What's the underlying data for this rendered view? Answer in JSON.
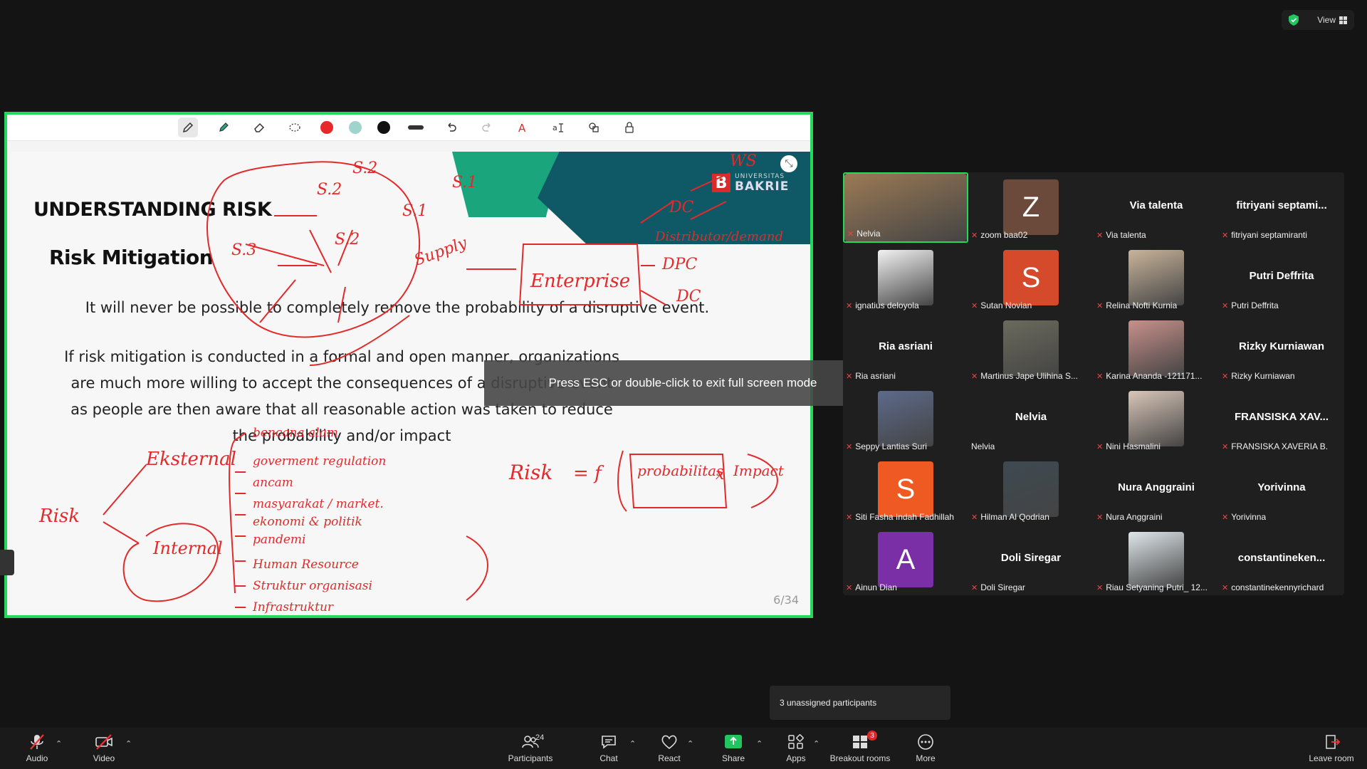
{
  "top_right": {
    "view_label": "View"
  },
  "toolbar": {
    "colors": [
      "#e8272a",
      "#9fd4cc",
      "#111111"
    ]
  },
  "slide": {
    "title": "UNDERSTANDING RISK",
    "subtitle": "Risk Mitigation",
    "para1": "It will never be possible to completely remove the probability of a disruptive event.",
    "para2": "If risk mitigation is conducted in a formal and open manner, organizations are much more willing to accept the consequences of a disruptive event as people are then aware that all reasonable action was taken to reduce the probability and/or impact",
    "page": "6/34",
    "logo_small": "UNIVERSITAS",
    "logo_big": "BAKRIE",
    "logo_letter": "B"
  },
  "ink": {
    "s2a": "S.2",
    "s2b": "S.2",
    "s2c": "S.2",
    "s1": "S.1",
    "s3": "S.3",
    "s1b": "S.1",
    "supply": "Supply",
    "enterprise": "Enterprise",
    "ws": "WS",
    "dc1": "DC",
    "distributor": "Distributor/demand",
    "dpc": "DPC",
    "dc2": "DC",
    "risk_left": "Risk",
    "eksternal": "Eksternal",
    "internal": "Internal",
    "b1": "bencana alam",
    "b2": "goverment regulation",
    "b3": "ancam",
    "b4": "masyarakat / market.",
    "b5": "ekonomi & politik",
    "b6": "pandemi",
    "b7": "Human Resource",
    "b8": "Struktur organisasi",
    "b9": "Infrastruktur",
    "formula_risk": "Risk",
    "formula_eq": "= f",
    "formula_prob": "probabilitas",
    "formula_x": "x",
    "formula_impact": "Impact"
  },
  "fullscreen_tip": "Press ESC or double-click to exit full screen mode",
  "gallery": [
    {
      "name": "Nelvia",
      "type": "photo",
      "color": "#9b7a55",
      "active": true
    },
    {
      "name": "zoom baa02",
      "type": "letter",
      "letter": "Z",
      "color": "#6b4a3c"
    },
    {
      "name": "Via talenta",
      "type": "text",
      "big": "Via talenta"
    },
    {
      "name": "fitriyani septamiranti",
      "type": "text",
      "big": "fitriyani  septami..."
    },
    {
      "name": "ignatius deloyola",
      "type": "photo",
      "color": "#f2f2f2"
    },
    {
      "name": "Sutan Novian",
      "type": "letter",
      "letter": "S",
      "color": "#d64a2c"
    },
    {
      "name": "Relina Nofti Kurnia",
      "type": "photo",
      "color": "#c9b49a"
    },
    {
      "name": "Putri Deffrita",
      "type": "text",
      "big": "Putri Deffrita"
    },
    {
      "name": "Ria asriani",
      "type": "text",
      "big": "Ria asriani"
    },
    {
      "name": "Martinus Jape Ulihina S...",
      "type": "photo",
      "color": "#6b6a5c"
    },
    {
      "name": "Karina Ananda -121171...",
      "type": "photo",
      "color": "#c8908a"
    },
    {
      "name": "Rizky Kurniawan",
      "type": "text",
      "big": "Rizky Kurniawan"
    },
    {
      "name": "Seppy Lantias Suri",
      "type": "photo",
      "color": "#5c6a8a"
    },
    {
      "name": "Nelvia",
      "type": "text",
      "big": "Nelvia",
      "no_mic": true
    },
    {
      "name": "Nini Hasmalini",
      "type": "photo",
      "color": "#d9c6b8"
    },
    {
      "name": "FRANSISKA XAVERIA B.",
      "type": "text",
      "big": "FRANSISKA  XAV..."
    },
    {
      "name": "Siti Fasha Indah Fadhillah",
      "type": "letter",
      "letter": "S",
      "color": "#ef5a23"
    },
    {
      "name": "Hilman Al Qodrian",
      "type": "photo",
      "color": "#3d4a52"
    },
    {
      "name": "Nura Anggraini",
      "type": "text",
      "big": "Nura Anggraini"
    },
    {
      "name": "Yorivinna",
      "type": "text",
      "big": "Yorivinna"
    },
    {
      "name": "Ainun Dian",
      "type": "letter",
      "letter": "A",
      "color": "#7b2fa6"
    },
    {
      "name": "Doli Siregar",
      "type": "text",
      "big": "Doli Siregar"
    },
    {
      "name": "Riau Setyaning Putri_ 12...",
      "type": "photo",
      "color": "#dfe6ea"
    },
    {
      "name": "constantinekennyrichard",
      "type": "text",
      "big": "constantineken..."
    }
  ],
  "breakout_popup": "3 unassigned participants",
  "bottombar": {
    "audio": "Audio",
    "video": "Video",
    "participants": "Participants",
    "participant_count": "24",
    "chat": "Chat",
    "react": "React",
    "share": "Share",
    "apps": "Apps",
    "breakout": "Breakout rooms",
    "breakout_badge": "3",
    "more": "More",
    "leave": "Leave room"
  }
}
